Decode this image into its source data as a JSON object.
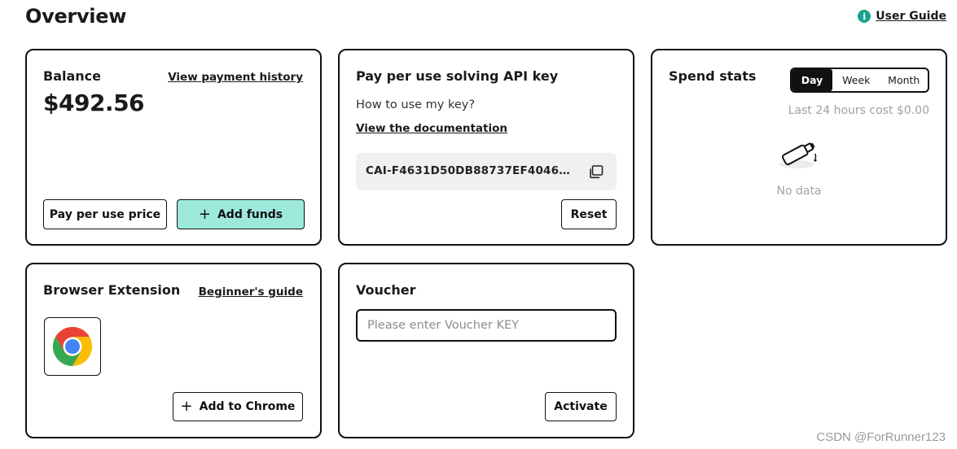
{
  "header": {
    "title": "Overview",
    "user_guide_label": "User Guide",
    "info_icon_glyph": "i"
  },
  "balance": {
    "title": "Balance",
    "amount": "$492.56",
    "payment_history_link": "View payment history",
    "pay_per_use_button": "Pay per use price",
    "add_funds_button": "Add funds",
    "add_funds_color": "#9ce9dc"
  },
  "api_key": {
    "title": "Pay per use solving API key",
    "howto_text": "How to use my key?",
    "documentation_link": "View the documentation",
    "key_value": "CAI-F4631D50DB88737EF40466377...",
    "reset_button": "Reset"
  },
  "spend_stats": {
    "title": "Spend stats",
    "periods": [
      "Day",
      "Week",
      "Month"
    ],
    "selected_period": "Day",
    "cost_text": "Last 24 hours cost $0.00",
    "no_data_text": "No data"
  },
  "extension": {
    "title": "Browser Extension",
    "guide_link": "Beginner's guide",
    "add_to_chrome_button": "Add to Chrome",
    "icon": "chrome-icon"
  },
  "voucher": {
    "title": "Voucher",
    "input_placeholder": "Please enter Voucher KEY",
    "input_value": "",
    "activate_button": "Activate"
  },
  "watermark": "CSDN @ForRunner123",
  "colors": {
    "accent": "#9ce9dc",
    "info_icon": "#1aa190",
    "border": "#111111"
  }
}
